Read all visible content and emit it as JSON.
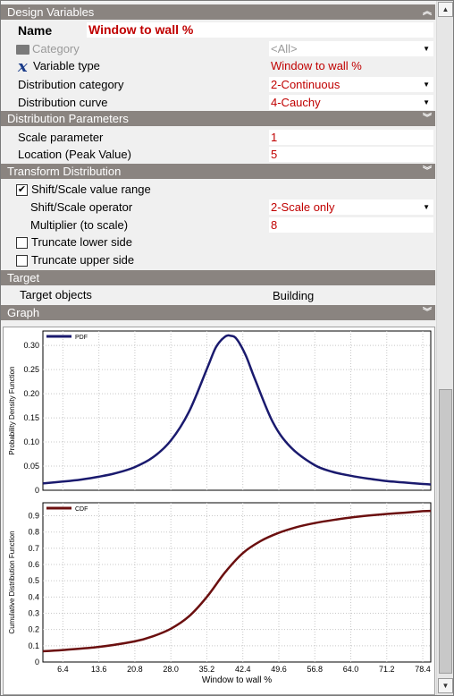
{
  "sections": {
    "design_variables": "Design Variables",
    "distribution_parameters": "Distribution Parameters",
    "transform_distribution": "Transform Distribution",
    "target": "Target",
    "graph": "Graph"
  },
  "name": {
    "label": "Name",
    "value": "Window to wall %"
  },
  "category": {
    "label": "Category",
    "value": "<All>"
  },
  "variable_type": {
    "label": "Variable type",
    "value": "Window to wall %"
  },
  "distribution_category": {
    "label": "Distribution category",
    "value": "2-Continuous"
  },
  "distribution_curve": {
    "label": "Distribution curve",
    "value": "4-Cauchy"
  },
  "scale_parameter": {
    "label": "Scale parameter",
    "value": "1"
  },
  "location": {
    "label": "Location (Peak Value)",
    "value": "5"
  },
  "shift_scale_range": {
    "label": "Shift/Scale value range",
    "checked": true
  },
  "shift_scale_operator": {
    "label": "Shift/Scale operator",
    "value": "2-Scale only"
  },
  "multiplier": {
    "label": "Multiplier (to scale)",
    "value": "8"
  },
  "truncate_lower": {
    "label": "Truncate lower side",
    "checked": false
  },
  "truncate_upper": {
    "label": "Truncate upper side",
    "checked": false
  },
  "target_objects": {
    "label": "Target objects",
    "value": "Building"
  },
  "colors": {
    "accent_red": "#c00000",
    "pdf_line": "#1a1a6e",
    "cdf_line": "#6b0f0f",
    "header": "#8a8480"
  },
  "chart_data": [
    {
      "type": "line",
      "legend": "PDF",
      "ylabel": "Probability Density Function",
      "yticks": [
        "0",
        "0.05",
        "0.10",
        "0.15",
        "0.20",
        "0.25",
        "0.30"
      ],
      "ylim": [
        0,
        0.33
      ],
      "xlim": [
        2.4,
        80.0
      ],
      "x": [
        2.4,
        6.4,
        10,
        13.6,
        17.2,
        20.8,
        24.4,
        28.0,
        31.6,
        35.2,
        37,
        38.8,
        40,
        41.2,
        43,
        44.8,
        48.4,
        52,
        56.8,
        60.4,
        64.0,
        67.6,
        71.2,
        74.8,
        78.4,
        80.0
      ],
      "y": [
        0.014,
        0.018,
        0.022,
        0.028,
        0.036,
        0.048,
        0.068,
        0.103,
        0.162,
        0.251,
        0.296,
        0.318,
        0.32,
        0.313,
        0.279,
        0.231,
        0.141,
        0.089,
        0.052,
        0.038,
        0.03,
        0.024,
        0.019,
        0.016,
        0.013,
        0.012
      ]
    },
    {
      "type": "line",
      "legend": "CDF",
      "ylabel": "Cumulative Distribution Function",
      "xlabel": "Window to wall %",
      "yticks": [
        "0",
        "0.1",
        "0.2",
        "0.3",
        "0.4",
        "0.5",
        "0.6",
        "0.7",
        "0.8",
        "0.9"
      ],
      "xticks": [
        "6.4",
        "13.6",
        "20.8",
        "28.0",
        "35.2",
        "42.4",
        "49.6",
        "56.8",
        "64.0",
        "71.2",
        "78.4"
      ],
      "ylim": [
        0,
        0.98
      ],
      "xlim": [
        2.4,
        80.0
      ],
      "x": [
        2.4,
        6.4,
        13.6,
        20.8,
        24.4,
        28.0,
        31.6,
        35.2,
        38.8,
        42.4,
        46.0,
        49.6,
        53.2,
        56.8,
        60.4,
        64.0,
        67.6,
        71.2,
        74.8,
        78.4,
        80.0
      ],
      "y": [
        0.066,
        0.074,
        0.093,
        0.127,
        0.158,
        0.205,
        0.28,
        0.4,
        0.55,
        0.67,
        0.745,
        0.795,
        0.83,
        0.855,
        0.874,
        0.889,
        0.901,
        0.911,
        0.919,
        0.928,
        0.93
      ]
    }
  ]
}
